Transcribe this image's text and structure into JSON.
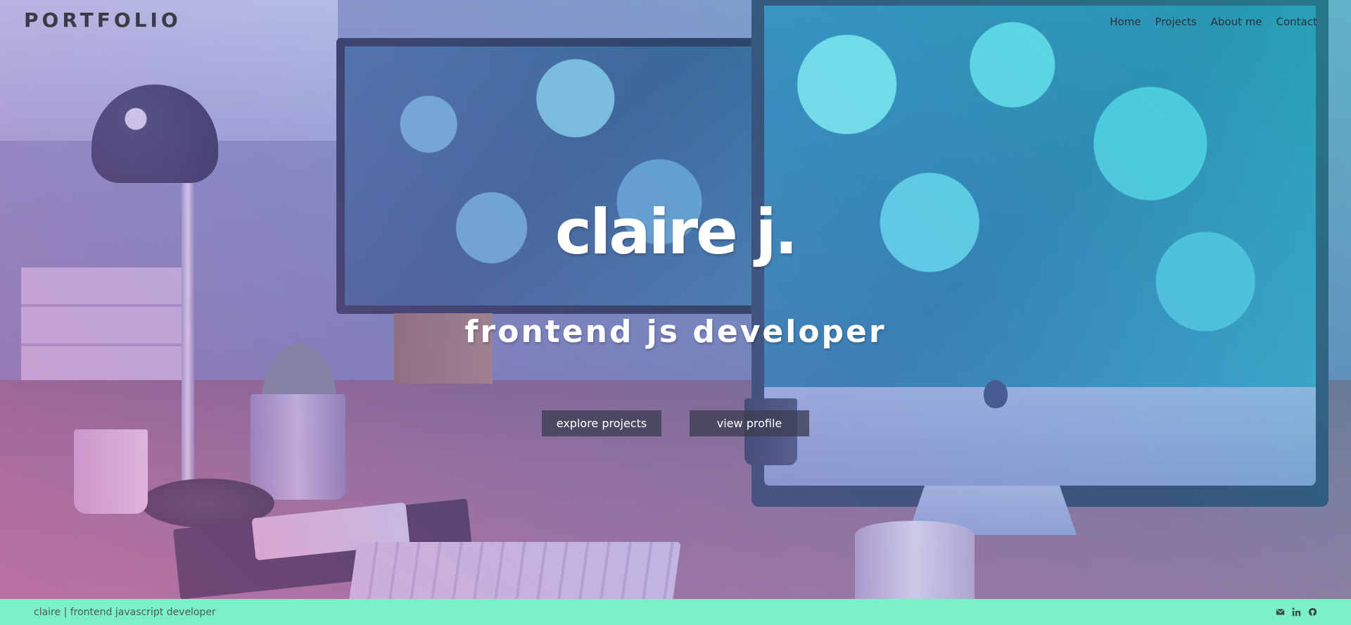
{
  "header": {
    "logo": "PORTFOLIO",
    "nav": [
      {
        "label": "Home"
      },
      {
        "label": "Projects"
      },
      {
        "label": "About me"
      },
      {
        "label": "Contact"
      }
    ]
  },
  "hero": {
    "name": "claire j.",
    "subtitle": "frontend js developer",
    "buttons": {
      "explore": "explore projects",
      "profile": "view profile"
    }
  },
  "footer": {
    "text": "claire  | frontend javascript developer",
    "icons": [
      "email-icon",
      "linkedin-icon",
      "github-icon"
    ]
  },
  "colors": {
    "footer_bg": "#7cf0c8",
    "button_bg": "#3c3e52",
    "tint_start": "#dc6eb4",
    "tint_end": "#1ed2c8"
  }
}
